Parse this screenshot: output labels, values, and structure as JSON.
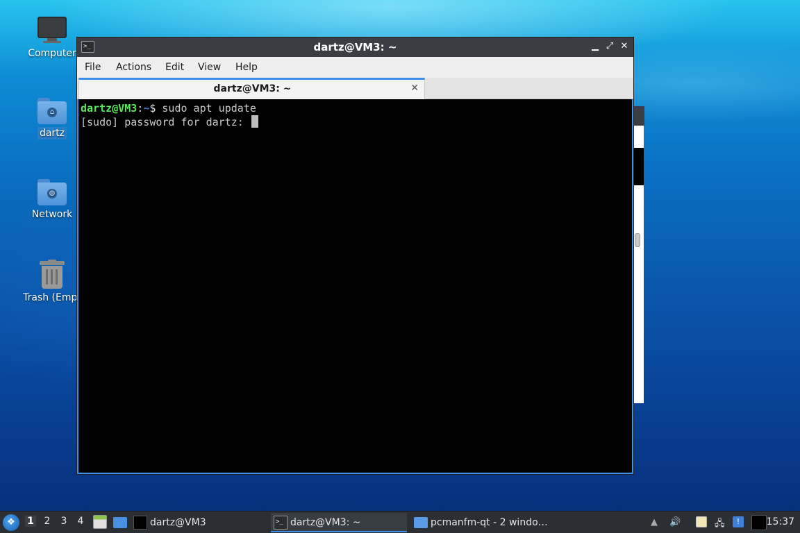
{
  "desktop": {
    "icons": [
      {
        "label": "Computer"
      },
      {
        "label": "dartz"
      },
      {
        "label": "Network"
      },
      {
        "label": "Trash (Empt"
      }
    ]
  },
  "window": {
    "title": "dartz@VM3: ~",
    "app_icon_glyph": ">_",
    "buttons": {
      "minimize": "▁",
      "maximize": "⤢",
      "close": "✕"
    },
    "menu": [
      "File",
      "Actions",
      "Edit",
      "View",
      "Help"
    ],
    "tab": {
      "label": "dartz@VM3: ~",
      "close": "✕"
    }
  },
  "terminal": {
    "line1": {
      "user_host": "dartz@VM3",
      "sep": ":",
      "path": "~",
      "prompt_symbol": "$",
      "command": " sudo apt update"
    },
    "line2": {
      "text": "[sudo] password for dartz: "
    }
  },
  "taskbar": {
    "start_glyph": "❖",
    "workspaces": [
      "1",
      "2",
      "3",
      "4"
    ],
    "active_workspace": "1",
    "tasks": [
      {
        "label": "dartz@VM3",
        "icon": "terminal-black-icon"
      },
      {
        "label": "dartz@VM3: ~",
        "icon": "terminal-icon",
        "active": true
      },
      {
        "label": "pcmanfm-qt - 2 windo…",
        "icon": "folder-icon"
      }
    ],
    "tray_glyphs": {
      "up": "▲",
      "volume": "🔊",
      "clipboard": "📋",
      "network": "🖧",
      "notify": "!"
    },
    "clock": "15:37"
  },
  "colors": {
    "accent": "#3d8ee6",
    "prompt_user": "#5ce65c",
    "prompt_path": "#4a7bd9",
    "titlebar": "#3a3e44",
    "taskbar": "#2b2e33"
  }
}
